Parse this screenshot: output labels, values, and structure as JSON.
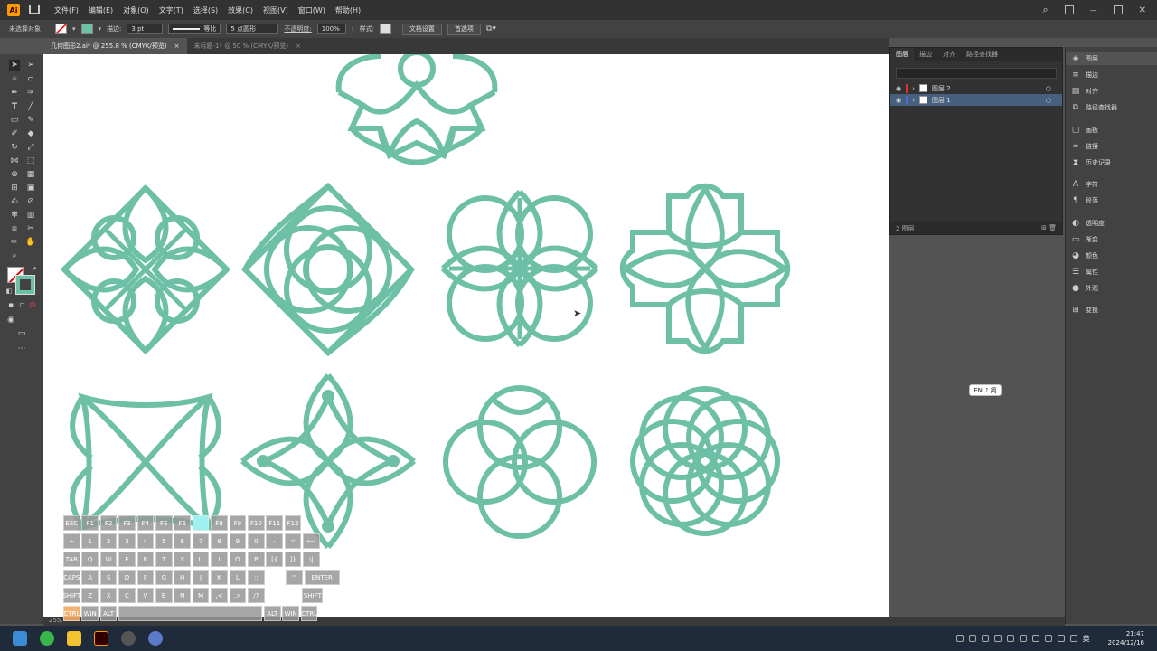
{
  "app": {
    "logo": "Ai"
  },
  "menu": [
    "文件(F)",
    "编辑(E)",
    "对象(O)",
    "文字(T)",
    "选择(S)",
    "效果(C)",
    "视图(V)",
    "窗口(W)",
    "帮助(H)"
  ],
  "control": {
    "no_selection": "未选择对象",
    "stroke_label": "描边:",
    "stroke_value": "3 pt",
    "profile": "等比",
    "brush": "5 点圆形",
    "opacity_label": "不透明度:",
    "opacity_value": "100%",
    "style_label": "样式:",
    "doc_setup": "文档设置",
    "prefs": "首选项"
  },
  "tabs": [
    {
      "label": "几何图形2.ai* @ 255.8 % (CMYK/预览)",
      "close": "×"
    },
    {
      "label": "未标题-1* @ 50 % (CMYK/预览)",
      "close": "×"
    }
  ],
  "layers_panel": {
    "tabs": [
      "图层",
      "描边",
      "对齐",
      "路径查找器"
    ],
    "layers": [
      {
        "name": "图层 2",
        "color": "#e03030"
      },
      {
        "name": "图层 1",
        "color": "#4a6fd0"
      }
    ],
    "footer": "2 图层"
  },
  "dock": [
    "图层",
    "描边",
    "对齐",
    "路径查找器",
    "画板",
    "链接",
    "历史记录",
    "字符",
    "段落",
    "透明度",
    "渐变",
    "颜色",
    "属性",
    "外观",
    "变换"
  ],
  "status": {
    "zoom": "255."
  },
  "ime": "EN ♪ 简",
  "keyboard": {
    "row1": [
      "ESC",
      "F1",
      "F2",
      "F3",
      "F4",
      "F5",
      "F6",
      "",
      "F8",
      "F9",
      "F10",
      "F11",
      "F12"
    ],
    "row2": [
      "~",
      "1",
      "2",
      "3",
      "4",
      "5",
      "6",
      "7",
      "8",
      "9",
      "0",
      "-",
      "=",
      "⟵"
    ],
    "row3": [
      "TAB",
      "Q",
      "W",
      "E",
      "R",
      "T",
      "Y",
      "U",
      "I",
      "O",
      "P",
      "[{",
      "]}",
      "\\|"
    ],
    "row4": [
      "CAPS",
      "A",
      "S",
      "D",
      "F",
      "G",
      "H",
      "J",
      "K",
      "L",
      ";:",
      "'\"",
      "ENTER"
    ],
    "row5": [
      "SHIFT",
      "Z",
      "X",
      "C",
      "V",
      "B",
      "N",
      "M",
      ",<",
      ".>",
      "/?",
      "SHIFT"
    ],
    "row6": [
      "CTRL",
      "WIN",
      "ALT",
      "",
      "ALT",
      "WIN",
      "CTRL"
    ]
  },
  "clock": {
    "time": "21:47",
    "date": "2024/12/16"
  },
  "tray_lang": "英",
  "colors": {
    "shape": "#6DC0A6"
  }
}
